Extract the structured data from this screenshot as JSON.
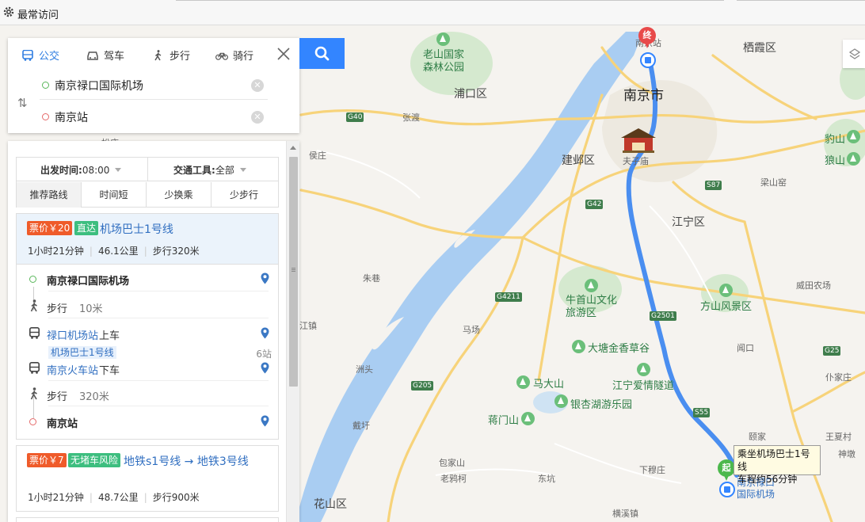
{
  "topbar": {
    "bookmark_label": "最常访问",
    "icon": "gear-icon"
  },
  "map_labels": {
    "city": "南京市",
    "districts": [
      "浦口区",
      "建邺区",
      "江宁区",
      "栖霞区",
      "花山区"
    ],
    "parks": [
      "老山国家森林公园",
      "牛首山文化旅游区",
      "方山风景区",
      "大塘金香草谷",
      "江宁爱情隧道",
      "马大山",
      "银杏湖游乐园",
      "蒋门山",
      "豹山",
      "狼山"
    ],
    "places": [
      "张渡",
      "侯庄",
      "朱巷",
      "江镇",
      "洲头",
      "戴圩",
      "包家山",
      "老鸦柯",
      "东坑",
      "下穆庄",
      "横溪镇",
      "王夏村",
      "仆家庄",
      "神墩",
      "闻口",
      "威田农场",
      "梁山窑",
      "颐家",
      "马场",
      "南京站",
      "夫子庙",
      "松庄"
    ],
    "roads": [
      "G40",
      "G42",
      "S87",
      "G4211",
      "G2501",
      "G205",
      "S55",
      "G25"
    ]
  },
  "search": {
    "modes": [
      {
        "label": "公交",
        "icon": "bus-icon",
        "active": true
      },
      {
        "label": "驾车",
        "icon": "car-icon",
        "active": false
      },
      {
        "label": "步行",
        "icon": "walk-icon",
        "active": false
      },
      {
        "label": "骑行",
        "icon": "bike-icon",
        "active": false
      }
    ],
    "origin": "南京禄口国际机场",
    "destination": "南京站"
  },
  "filters": {
    "depart_label": "出发时间:",
    "depart_value": "08:00",
    "vehicle_label": "交通工具:",
    "vehicle_value": "全部",
    "tabs": [
      "推荐路线",
      "时间短",
      "少换乘",
      "少步行"
    ]
  },
  "routes": [
    {
      "fare": "票价￥20",
      "tag": "直达",
      "title": "机场巴士1号线",
      "duration": "1小时21分钟",
      "distance": "46.1公里",
      "walk": "步行320米",
      "steps": {
        "start": "南京禄口国际机场",
        "walk1": "步行",
        "walk1_dist": "10米",
        "board_station": "禄口机场站",
        "board_action": "上车",
        "line": "机场巴士1号线",
        "stops": "6站",
        "alight_station": "南京火车站",
        "alight_action": "下车",
        "walk2": "步行",
        "walk2_dist": "320米",
        "end": "南京站"
      }
    },
    {
      "fare": "票价￥7",
      "tag": "无堵车风险",
      "title": "地铁s1号线 → 地铁3号线",
      "duration": "1小时21分钟",
      "distance": "48.7公里",
      "walk": "步行900米"
    }
  ],
  "map_overlay": {
    "start_marker": "起",
    "end_marker": "终",
    "tooltip_line1": "乘坐机场巴士1号线",
    "tooltip_line2": "车程约56分钟",
    "start_name": "南京禄口国际机场"
  },
  "colors": {
    "route_line": "#4a8ef0",
    "accent": "#3385ff",
    "fare_tag": "#ef5b2a",
    "direct_tag": "#3dbe7f",
    "river": "#a9cdf2"
  }
}
